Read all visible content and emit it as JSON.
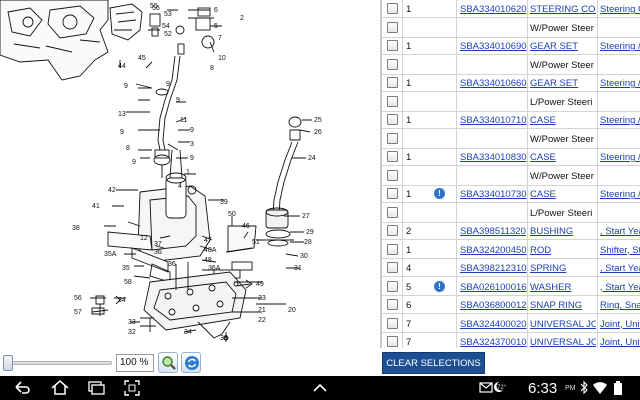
{
  "diagram": {
    "callouts": [
      "56",
      "53",
      "6",
      "2",
      "55",
      "54",
      "52",
      "5",
      "44",
      "45",
      "7",
      "8",
      "10",
      "9",
      "9",
      "9",
      "13",
      "11",
      "9",
      "9",
      "8",
      "3",
      "9",
      "25",
      "26",
      "24",
      "1",
      "39",
      "41",
      "42",
      "38",
      "35A",
      "37",
      "36",
      "36",
      "27",
      "29",
      "28",
      "30",
      "31",
      "50",
      "46",
      "51",
      "47",
      "48A",
      "48",
      "57",
      "56",
      "34",
      "33",
      "32",
      "34",
      "38",
      "23",
      "21",
      "22",
      "20",
      "35",
      "36A",
      "49",
      "58",
      "12",
      "4"
    ]
  },
  "zoom": {
    "value": "100 %"
  },
  "parts": {
    "rows": [
      {
        "qty": "1",
        "info": false,
        "part_no": "SBA334010620",
        "desc": "STEERING COL",
        "remark": "Steering Col",
        "sub": "W/Power Steer"
      },
      {
        "qty": "1",
        "info": false,
        "part_no": "SBA334010690",
        "desc": "GEAR SET",
        "remark": "Steering / Gear",
        "sub": "W/Power Steer"
      },
      {
        "qty": "1",
        "info": false,
        "part_no": "SBA334010660",
        "desc": "GEAR SET",
        "remark": "Steering / Gear",
        "sub": "L/Power Steeri"
      },
      {
        "qty": "1",
        "info": false,
        "part_no": "SBA334010710",
        "desc": "CASE",
        "remark": "Steering / Case",
        "sub": "W/Power Steer"
      },
      {
        "qty": "1",
        "info": false,
        "part_no": "SBA334010830",
        "desc": "CASE",
        "remark": "Steering / Case",
        "sub": "W/Power Steer"
      },
      {
        "qty": "1",
        "info": true,
        "part_no": "SBA334010730",
        "desc": "CASE",
        "remark": "Steering / Case",
        "sub": "L/Power Steeri"
      },
      {
        "qty": "2",
        "info": false,
        "part_no": "SBA398511320",
        "desc": "BUSHING",
        "remark": ", Start Year",
        "sub": ""
      },
      {
        "qty": "1",
        "info": false,
        "part_no": "SBA324200450",
        "desc": "ROD",
        "remark": "Shifter, Steering",
        "sub": ""
      },
      {
        "qty": "4",
        "info": false,
        "part_no": "SBA398212310",
        "desc": "SPRING",
        "remark": ", Start Year",
        "sub": ""
      },
      {
        "qty": "5",
        "info": true,
        "part_no": "SBA026100016",
        "desc": "WASHER",
        "remark": ", Start Year",
        "sub": ""
      },
      {
        "qty": "6",
        "info": false,
        "part_no": "SBA036800012",
        "desc": "SNAP RING",
        "remark": "Ring, Snap",
        "sub": ""
      },
      {
        "qty": "7",
        "info": false,
        "part_no": "SBA324400020",
        "desc": "UNIVERSAL JO",
        "remark": "Joint, Universal",
        "sub": ""
      },
      {
        "qty": "7",
        "info": false,
        "part_no": "SBA324370010",
        "desc": "UNIVERSAL JO",
        "remark": "Joint, Universal",
        "sub": ""
      }
    ]
  },
  "actions": {
    "clear_label": "CLEAR SELECTIONS"
  },
  "status": {
    "time": "6:33",
    "ampm": "PM",
    "temp": "72°"
  },
  "icons": {
    "back": "back-arrow-icon",
    "home": "home-icon",
    "recent": "recent-apps-icon",
    "screenshot": "screenshot-icon",
    "up": "chevron-up-icon",
    "mail": "mail-icon",
    "weather": "weather-moon-icon",
    "bluetooth": "bluetooth-icon",
    "wifi": "wifi-icon",
    "battery": "battery-icon",
    "zoom": "zoom-icon",
    "refresh": "refresh-icon",
    "info": "info-icon"
  },
  "colors": {
    "link": "#1a3fb5",
    "button": "#1e4f95",
    "info": "#2f72c4",
    "navbar": "#000000"
  }
}
